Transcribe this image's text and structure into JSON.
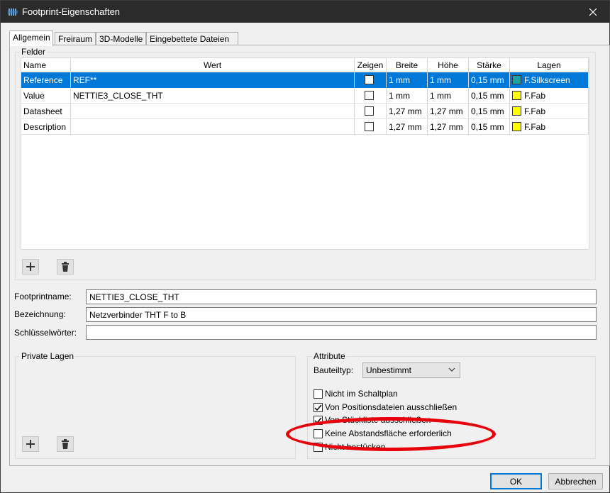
{
  "window": {
    "title": "Footprint-Eigenschaften"
  },
  "tabs": [
    "Allgemein",
    "Freiraum",
    "3D-Modelle",
    "Eingebettete Dateien"
  ],
  "fields_group": {
    "legend": "Felder",
    "columns": [
      "Name",
      "Wert",
      "Zeigen",
      "Breite",
      "Höhe",
      "Stärke",
      "Lagen"
    ],
    "rows": [
      {
        "name": "Reference",
        "value": "REF**",
        "show": false,
        "width": "1 mm",
        "height": "1 mm",
        "thickness": "0,15 mm",
        "layer": "F.Silkscreen",
        "layer_color": "#1aa3a3",
        "selected": true
      },
      {
        "name": "Value",
        "value": "NETTIE3_CLOSE_THT",
        "show": false,
        "width": "1 mm",
        "height": "1 mm",
        "thickness": "0,15 mm",
        "layer": "F.Fab",
        "layer_color": "#ffff00",
        "selected": false
      },
      {
        "name": "Datasheet",
        "value": "",
        "show": false,
        "width": "1,27 mm",
        "height": "1,27 mm",
        "thickness": "0,15 mm",
        "layer": "F.Fab",
        "layer_color": "#ffff00",
        "selected": false
      },
      {
        "name": "Description",
        "value": "",
        "show": false,
        "width": "1,27 mm",
        "height": "1,27 mm",
        "thickness": "0,15 mm",
        "layer": "F.Fab",
        "layer_color": "#ffff00",
        "selected": false
      }
    ]
  },
  "form": {
    "footprint_label": "Footprintname:",
    "footprint_value": "NETTIE3_CLOSE_THT",
    "description_label": "Bezeichnung:",
    "description_value": "Netzverbinder THT F to B",
    "keywords_label": "Schlüsselwörter:",
    "keywords_value": ""
  },
  "private_layers": {
    "legend": "Private Lagen"
  },
  "attributes": {
    "legend": "Attribute",
    "type_label": "Bauteiltyp:",
    "type_value": "Unbestimmt",
    "checks": [
      {
        "label": "Nicht im Schaltplan",
        "checked": false
      },
      {
        "label": "Von Positionsdateien ausschließen",
        "checked": true
      },
      {
        "label": "Von Stückliste ausschließen",
        "checked": true
      },
      {
        "label": "Keine Abstandsfläche erforderlich",
        "checked": false
      },
      {
        "label": "Nicht bestücken",
        "checked": false
      }
    ]
  },
  "buttons": {
    "ok": "OK",
    "cancel": "Abbrechen"
  },
  "annotation": {
    "color": "#e8000c"
  }
}
